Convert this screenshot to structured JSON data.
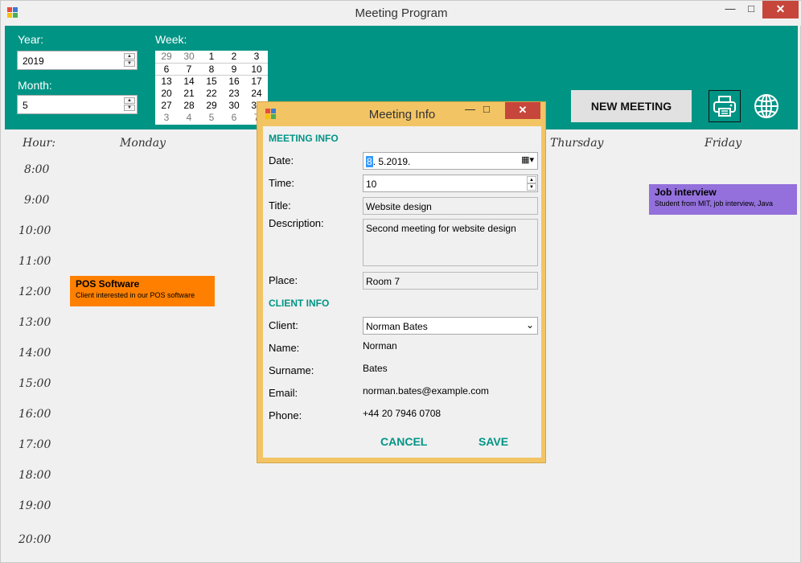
{
  "window": {
    "title": "Meeting Program"
  },
  "colors": {
    "accent": "#009485",
    "dialog_frame": "#f2c464",
    "event_orange": "#ff8000",
    "event_purple": "#9370db",
    "close_red": "#c7463b"
  },
  "header": {
    "year_label": "Year:",
    "year_value": "2019",
    "month_label": "Month:",
    "month_value": "5",
    "week_label": "Week:",
    "calendar_rows": [
      [
        "29",
        "30",
        "1",
        "2",
        "3"
      ],
      [
        "6",
        "7",
        "8",
        "9",
        "10"
      ],
      [
        "13",
        "14",
        "15",
        "16",
        "17"
      ],
      [
        "20",
        "21",
        "22",
        "23",
        "24"
      ],
      [
        "27",
        "28",
        "29",
        "30",
        "31"
      ],
      [
        "3",
        "4",
        "5",
        "6",
        "7"
      ]
    ],
    "new_meeting_label": "NEW MEETING",
    "print_icon": "printer-icon",
    "language_icon": "globe-icon"
  },
  "schedule": {
    "hour_label": "Hour:",
    "days": [
      "Monday",
      "Thursday",
      "Friday"
    ],
    "hours": [
      "8:00",
      "9:00",
      "10:00",
      "11:00",
      "12:00",
      "13:00",
      "14:00",
      "15:00",
      "16:00",
      "17:00",
      "18:00",
      "19:00",
      "20:00"
    ],
    "events": [
      {
        "title": "POS Software",
        "description": "Client interested in our POS software",
        "color": "#ff8000"
      },
      {
        "title": "Job interview",
        "description": "Student from MIT, job interview, Java",
        "color": "#9370db"
      }
    ]
  },
  "dialog": {
    "title": "Meeting Info",
    "meeting_section": "MEETING INFO",
    "date_label": "Date:",
    "date_day": "8",
    "date_rest": ".  5.2019.",
    "time_label": "Time:",
    "time_value": "10",
    "title_label": "Title:",
    "title_value": "Website design",
    "description_label": "Description:",
    "description_value": "Second meeting for website design",
    "place_label": "Place:",
    "place_value": "Room 7",
    "client_section": "CLIENT INFO",
    "client_label": "Client:",
    "client_value": "Norman Bates",
    "name_label": "Name:",
    "name_value": "Norman",
    "surname_label": "Surname:",
    "surname_value": "Bates",
    "email_label": "Email:",
    "email_value": "norman.bates@example.com",
    "phone_label": "Phone:",
    "phone_value": "+44 20 7946 0708",
    "cancel_label": "CANCEL",
    "save_label": "SAVE"
  }
}
